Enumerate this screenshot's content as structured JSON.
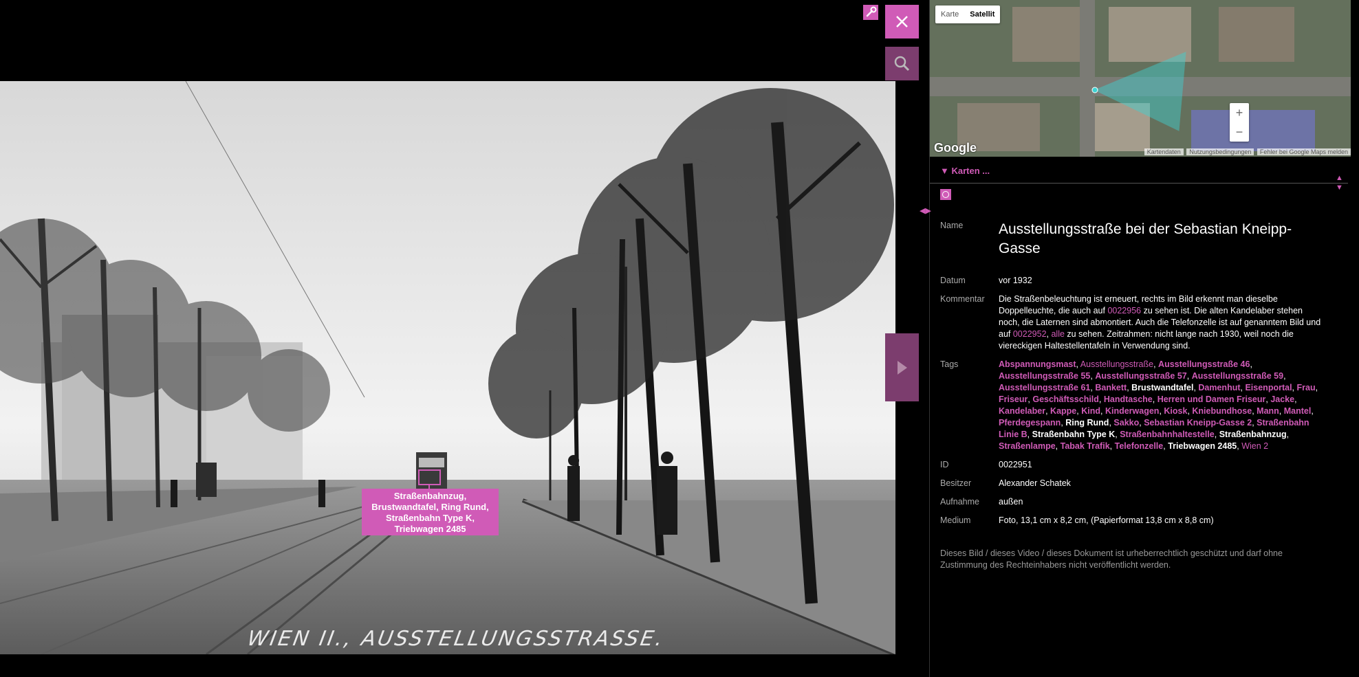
{
  "photo": {
    "tag_label": "Straßenbahnzug, Brustwandtafel, Ring Rund, Straßenbahn Type K, Triebwagen 2485",
    "caption": "WIEN II., AUSSTELLUNGSSTRASSE."
  },
  "toolbar": {
    "close_icon": "close-icon",
    "search_icon": "search-icon",
    "wrench_icon": "wrench-icon",
    "next_icon": "chevron-right-icon"
  },
  "map": {
    "type_map": "Karte",
    "type_satellite": "Satellit",
    "selected": "Satellit",
    "zoom_in": "+",
    "zoom_out": "−",
    "logo": "Google",
    "footer": [
      "Kartendaten",
      "Nutzungsbedingungen",
      "Fehler bei Google Maps melden"
    ]
  },
  "panel": {
    "karten_toggle": "▼ Karten ...",
    "arrows_updown": "▲▼",
    "arrows_leftright": "◀▶"
  },
  "details": {
    "name_label": "Name",
    "name": "Ausstellungsstraße bei der Sebastian Kneipp-Gasse",
    "date_label": "Datum",
    "date": "vor 1932",
    "comment_label": "Kommentar",
    "comment_1": "Die Straßenbeleuchtung ist erneuert, rechts im Bild erkennt man dieselbe Doppelleuchte, die auch auf ",
    "comment_link_1": "0022956",
    "comment_2": " zu sehen ist. Die alten Kandelaber stehen noch, die Laternen sind abmontiert. Auch die Telefonzelle ist auf genanntem Bild und auf ",
    "comment_link_2": "0022952",
    "comment_3": ", ",
    "comment_link_3": "alle",
    "comment_4": " zu sehen. Zeitrahmen: nicht lange nach 1930, weil noch die viereckigen Haltestellentafeln in Verwendung sind.",
    "tags_label": "Tags",
    "tags": [
      {
        "t": "Abspannungsmast",
        "s": "b"
      },
      {
        "t": "Ausstellungsstraße",
        "s": "n"
      },
      {
        "t": "Ausstellungsstraße 46",
        "s": "b"
      },
      {
        "t": "Ausstellungsstraße 55",
        "s": "b"
      },
      {
        "t": "Ausstellungsstraße 57",
        "s": "b"
      },
      {
        "t": "Ausstellungsstraße 59",
        "s": "b"
      },
      {
        "t": "Ausstellungsstraße 61",
        "s": "b"
      },
      {
        "t": "Bankett",
        "s": "b"
      },
      {
        "t": "Brustwandtafel",
        "s": "w"
      },
      {
        "t": "Damenhut",
        "s": "b"
      },
      {
        "t": "Eisenportal",
        "s": "b"
      },
      {
        "t": "Frau",
        "s": "b"
      },
      {
        "t": "Friseur",
        "s": "b"
      },
      {
        "t": "Geschäftsschild",
        "s": "b"
      },
      {
        "t": "Handtasche",
        "s": "b"
      },
      {
        "t": "Herren und Damen Friseur",
        "s": "b"
      },
      {
        "t": "Jacke",
        "s": "b"
      },
      {
        "t": "Kandelaber",
        "s": "b"
      },
      {
        "t": "Kappe",
        "s": "b"
      },
      {
        "t": "Kind",
        "s": "b"
      },
      {
        "t": "Kinderwagen",
        "s": "b"
      },
      {
        "t": "Kiosk",
        "s": "b"
      },
      {
        "t": "Kniebundhose",
        "s": "b"
      },
      {
        "t": "Mann",
        "s": "b"
      },
      {
        "t": "Mantel",
        "s": "b"
      },
      {
        "t": "Pferdegespann",
        "s": "b"
      },
      {
        "t": "Ring Rund",
        "s": "w"
      },
      {
        "t": "Sakko",
        "s": "b"
      },
      {
        "t": "Sebastian Kneipp-Gasse 2",
        "s": "b"
      },
      {
        "t": "Straßenbahn Linie B",
        "s": "b"
      },
      {
        "t": "Straßenbahn Type K",
        "s": "w"
      },
      {
        "t": "Straßenbahnhaltestelle",
        "s": "b"
      },
      {
        "t": "Straßenbahnzug",
        "s": "w"
      },
      {
        "t": "Straßenlampe",
        "s": "b"
      },
      {
        "t": "Tabak Trafik",
        "s": "b"
      },
      {
        "t": "Telefonzelle",
        "s": "b"
      },
      {
        "t": "Triebwagen 2485",
        "s": "w"
      },
      {
        "t": "Wien 2",
        "s": "n"
      }
    ],
    "id_label": "ID",
    "id": "0022951",
    "owner_label": "Besitzer",
    "owner": "Alexander Schatek",
    "shot_label": "Aufnahme",
    "shot": "außen",
    "medium_label": "Medium",
    "medium": "Foto, 13,1 cm x 8,2 cm, (Papierformat 13,8 cm x 8,8 cm)"
  },
  "copyright": "Dieses Bild / dieses Video / dieses Dokument ist urheberrechtlich geschützt und darf ohne Zustimmung des Rechteinhabers nicht veröffentlicht werden.",
  "colors": {
    "accent": "#d05bb7",
    "accent_dark": "#7c3d6e",
    "background": "#000000"
  }
}
